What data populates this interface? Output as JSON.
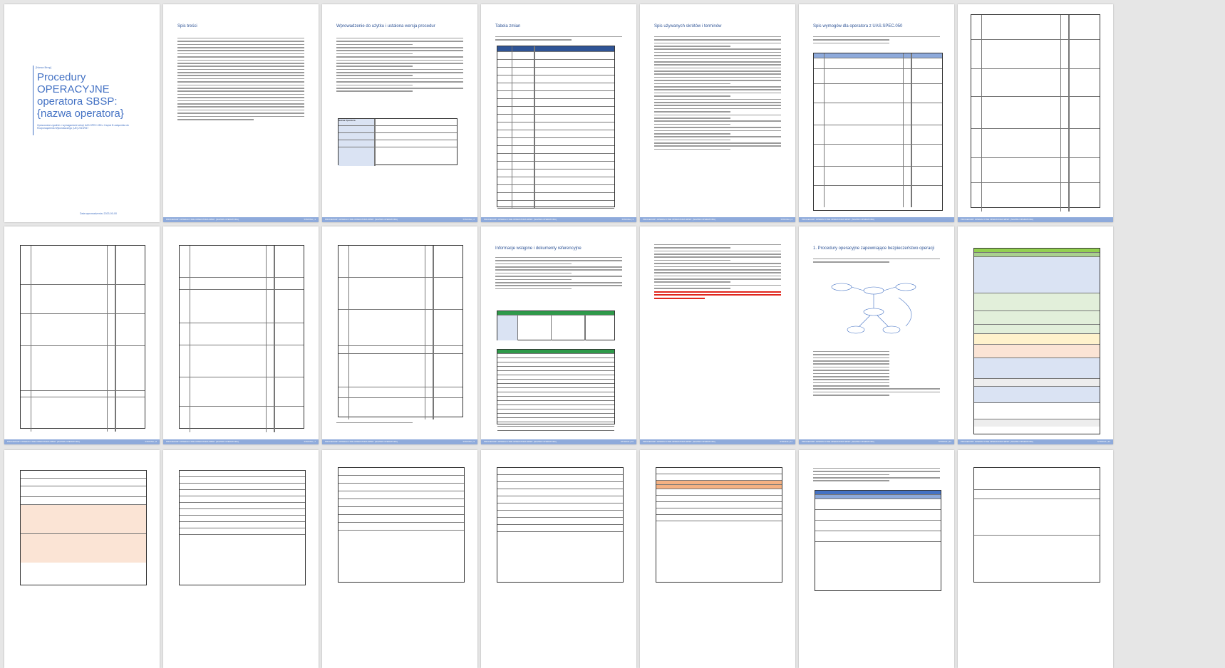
{
  "cover": {
    "tag": "[Nowa Brnę]",
    "title": "Procedury OPERACYJNE operatora SBSP: {nazwa operatora}",
    "subtitle": "Opracowane zgodnie z wymaganiami sekcji UAS.SPEC.050 z Części B załącznika do Rozporządzenia Wykonawczego (UE) 2019/947",
    "date": "Data wprowadzenia: 2023-00-00"
  },
  "footer": {
    "left": "PROCEDURY OPERACYJNE OPERATORA SBSP: {NAZWA OPERATORA}"
  },
  "pages": [
    {
      "heading": "Spis treści",
      "number": "STRONA | 1"
    },
    {
      "heading": "Wprowadzenie do użytku i ustalona wersja procedur",
      "number": "STRONA | 2"
    },
    {
      "heading": "Tabela zmian",
      "number": "STRONA | 3"
    },
    {
      "heading": "Spis używanych skrótów i terminów",
      "number": "STRONA | 4"
    },
    {
      "heading": "Spis wymogów dla operatora z UAS.SPEC.050",
      "number": "STRONA | 5"
    },
    {
      "heading": "",
      "number": "STRONA | 6"
    },
    {
      "heading": "",
      "number": "STRONA | 7"
    },
    {
      "heading": "",
      "number": "STRONA | 8"
    },
    {
      "heading": "",
      "number": "STRONA | 9"
    },
    {
      "heading": "Informacje wstępne i dokumenty referencyjne",
      "number": "STRONA | 10"
    },
    {
      "heading": "",
      "number": "STRONA | 11"
    },
    {
      "heading": "1. Procedury operacyjne zapewniające bezpieczeństwo operacji",
      "number": "STRONA | 12"
    },
    {
      "heading": "",
      "number": "STRONA | 13"
    },
    {
      "heading": "",
      "number": "STRONA | 14"
    }
  ],
  "table_tag": "Nazwa Operatora"
}
